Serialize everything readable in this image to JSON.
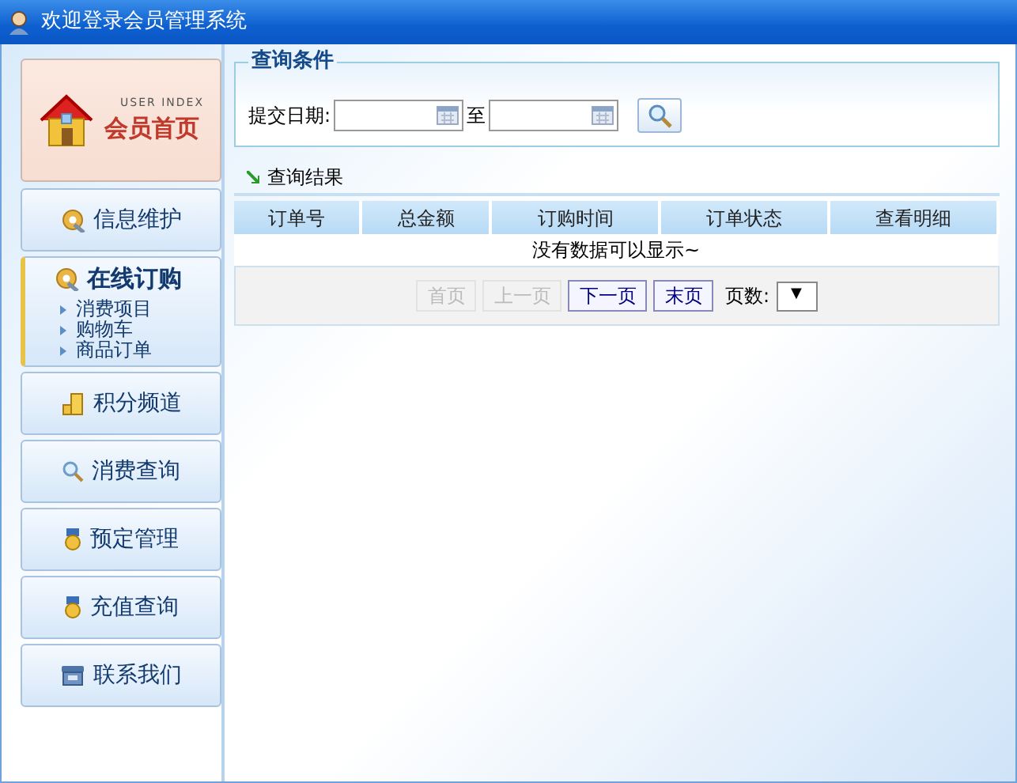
{
  "window": {
    "title": "欢迎登录会员管理系统"
  },
  "sidebar": {
    "home": {
      "caption": "USER INDEX",
      "label": "会员首页"
    },
    "items": [
      {
        "label": "信息维护",
        "selected": false
      },
      {
        "label": "在线订购",
        "selected": true,
        "expanded": true,
        "children": [
          {
            "label": "消费项目"
          },
          {
            "label": "购物车"
          },
          {
            "label": "商品订单"
          }
        ]
      },
      {
        "label": "积分频道",
        "selected": false
      },
      {
        "label": "消费查询",
        "selected": false
      },
      {
        "label": "预定管理",
        "selected": false
      },
      {
        "label": "充值查询",
        "selected": false
      },
      {
        "label": "联系我们",
        "selected": false
      }
    ]
  },
  "query": {
    "legend": "查询条件",
    "date_label": "提交日期:",
    "to_label": "至"
  },
  "results": {
    "title": "查询结果",
    "table": {
      "columns": [
        "订单号",
        "总金额",
        "订购时间",
        "订单状态",
        "查看明细"
      ],
      "empty_message": "没有数据可以显示~"
    },
    "pager": {
      "buttons": [
        {
          "label": "首页",
          "disabled": true
        },
        {
          "label": "上一页",
          "disabled": true
        },
        {
          "label": "下一页",
          "disabled": false
        },
        {
          "label": "末页",
          "disabled": false
        }
      ],
      "page_label": "页数:",
      "page_select": "▼"
    }
  }
}
